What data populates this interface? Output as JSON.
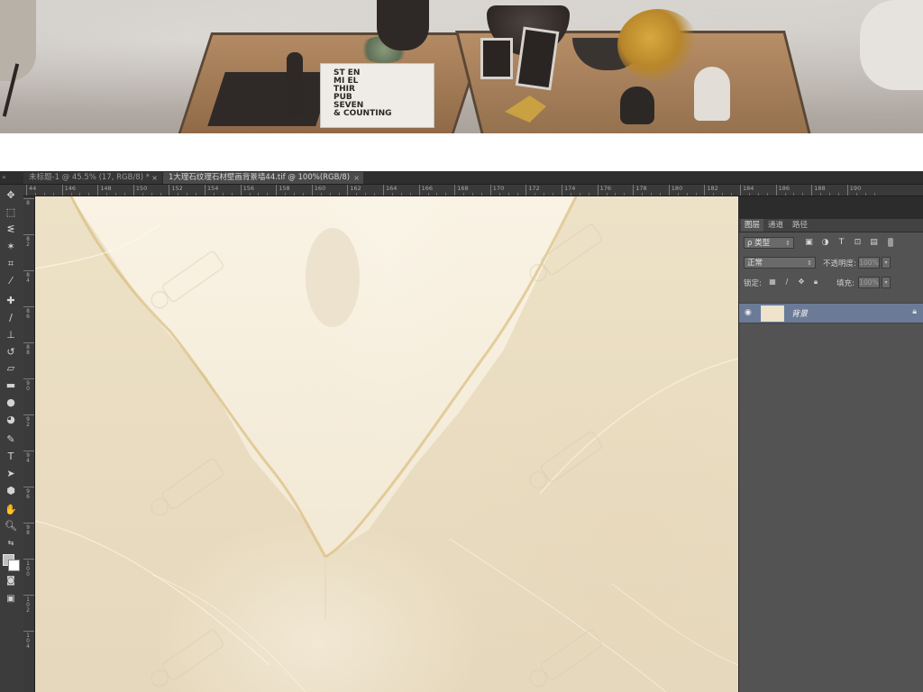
{
  "document_tabs": [
    {
      "label": "未标题-1 @ 45.5% (17, RGB/8) *",
      "active": false
    },
    {
      "label": "1大理石纹理石材壁画背景墙44.tif @ 100%(RGB/8)",
      "active": true,
      "close": "×"
    }
  ],
  "tab_close_inactive": "×",
  "ruler_top_labels": [
    "44",
    "146",
    "148",
    "150",
    "152",
    "154",
    "156",
    "158",
    "160",
    "162",
    "164",
    "166",
    "168",
    "170",
    "172",
    "174",
    "176",
    "178",
    "180",
    "182",
    "184",
    "186",
    "188",
    "190"
  ],
  "ruler_left_labels": [
    "8",
    "8\n2",
    "8\n4",
    "8\n6",
    "8\n8",
    "9\n0",
    "9\n2",
    "9\n4",
    "9\n6",
    "9\n8",
    "1\n0\n0",
    "1\n0\n2",
    "1\n0\n4"
  ],
  "layers_panel": {
    "tabs": [
      "图层",
      "通道",
      "路径"
    ],
    "active_tab": "图层",
    "filter_label": "ρ 类型",
    "blend_mode": "正常",
    "opacity_label": "不透明度:",
    "opacity_value": "100%",
    "lock_label": "锁定:",
    "fill_label": "填充:",
    "fill_value": "100%",
    "layers": [
      {
        "name": "背景",
        "visible": true,
        "locked": true,
        "thumbnail_color": "#efe4cb"
      }
    ]
  },
  "book_text": [
    "ST  EN",
    "MI  EL",
    "THIR",
    "PUB",
    "SEVEN",
    "& COUNTING"
  ],
  "colors": {
    "ps_background": "#2c2c2c",
    "panel_background": "#535353",
    "selected_layer": "#6b7b97",
    "marble_base": "#ede2c7"
  }
}
